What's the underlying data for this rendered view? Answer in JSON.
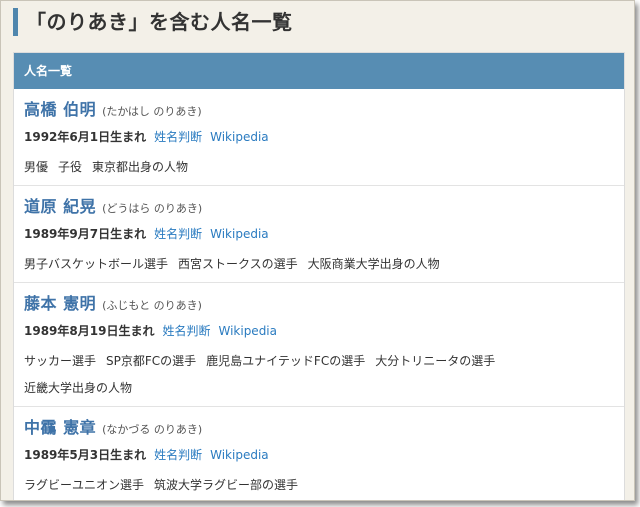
{
  "page": {
    "title": "「のりあき」を含む人名一覧"
  },
  "list": {
    "header": "人名一覧",
    "people": [
      {
        "name": "高橋 伯明",
        "reading": "(たかはし のりあき)",
        "birth": "1992年6月1日生まれ",
        "link_seimei": "姓名判断",
        "link_wiki": "Wikipedia",
        "categories": [
          "男優",
          "子役",
          "東京都出身の人物"
        ]
      },
      {
        "name": "道原 紀晃",
        "reading": "(どうはら のりあき)",
        "birth": "1989年9月7日生まれ",
        "link_seimei": "姓名判断",
        "link_wiki": "Wikipedia",
        "categories": [
          "男子バスケットボール選手",
          "西宮ストークスの選手",
          "大阪商業大学出身の人物"
        ]
      },
      {
        "name": "藤本 憲明",
        "reading": "(ふじもと のりあき)",
        "birth": "1989年8月19日生まれ",
        "link_seimei": "姓名判断",
        "link_wiki": "Wikipedia",
        "categories": [
          "サッカー選手",
          "SP京都FCの選手",
          "鹿児島ユナイテッドFCの選手",
          "大分トリニータの選手",
          "近畿大学出身の人物"
        ]
      },
      {
        "name": "中靍 憲章",
        "reading": "(なかづる のりあき)",
        "birth": "1989年5月3日生まれ",
        "link_seimei": "姓名判断",
        "link_wiki": "Wikipedia",
        "categories": [
          "ラグビーユニオン選手",
          "筑波大学ラグビー部の選手"
        ]
      }
    ]
  }
}
